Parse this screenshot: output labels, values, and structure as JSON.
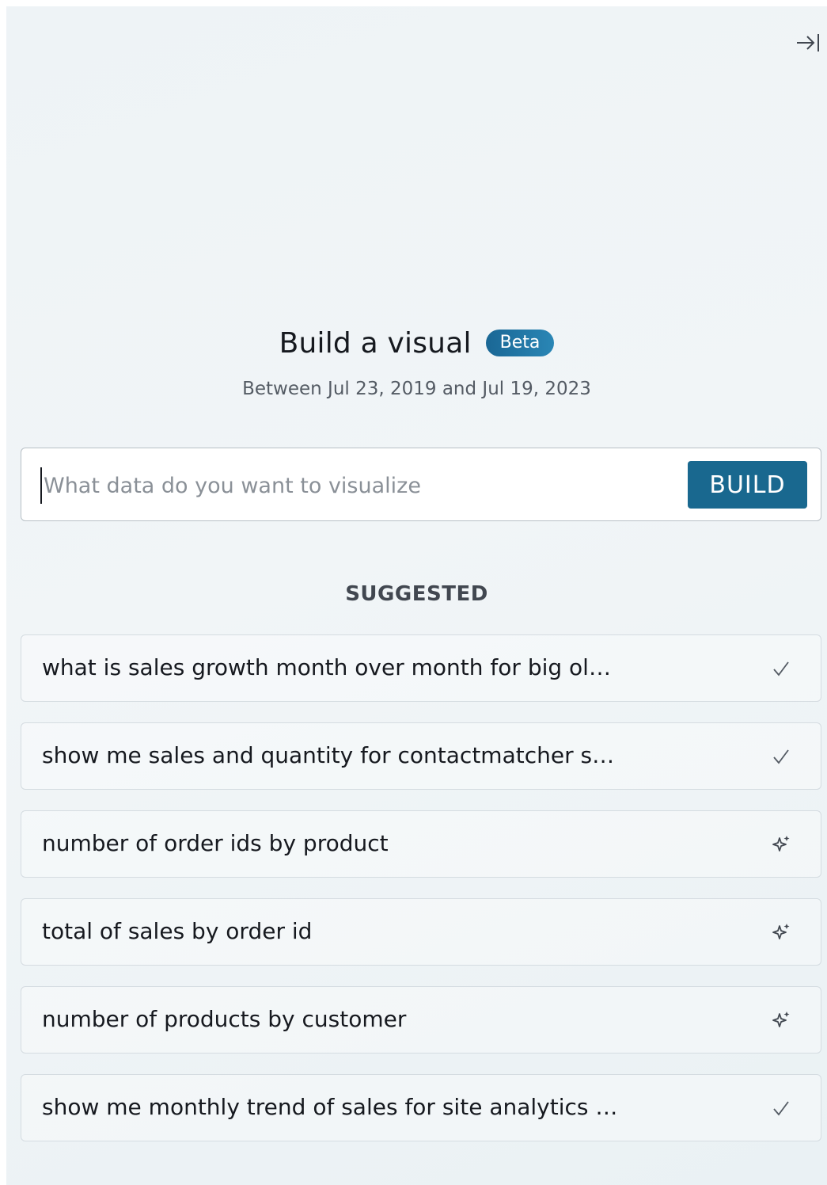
{
  "header": {
    "title": "Build a visual",
    "badge": "Beta",
    "date_range": "Between Jul 23, 2019 and Jul 19, 2023"
  },
  "search": {
    "placeholder": "What data do you want to visualize",
    "value": "",
    "build_label": "BUILD"
  },
  "suggested": {
    "heading": "SUGGESTED",
    "items": [
      {
        "label": "what is sales growth month over month for big ol…",
        "icon": "check-icon"
      },
      {
        "label": "show me sales and quantity for contactmatcher s…",
        "icon": "check-icon"
      },
      {
        "label": "number of order ids by product",
        "icon": "sparkle-icon"
      },
      {
        "label": "total of sales by order id",
        "icon": "sparkle-icon"
      },
      {
        "label": "number of products by customer",
        "icon": "sparkle-icon"
      },
      {
        "label": "show me monthly trend of sales for site analytics …",
        "icon": "check-icon"
      }
    ]
  },
  "colors": {
    "accent": "#19688f",
    "badge": "#1a6795"
  }
}
